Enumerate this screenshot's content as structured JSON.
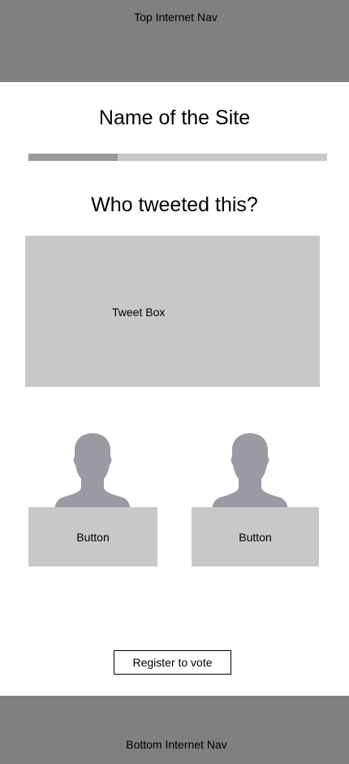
{
  "top_nav": {
    "label": "Top Internet Nav"
  },
  "site": {
    "title": "Name of the Site"
  },
  "progress": {
    "fraction": 0.3
  },
  "question": {
    "text": "Who tweeted this?"
  },
  "tweet_box": {
    "label": "Tweet Box"
  },
  "candidates": [
    {
      "avatar_icon": "person-silhouette-icon",
      "button_label": "Button"
    },
    {
      "avatar_icon": "person-silhouette-icon",
      "button_label": "Button"
    }
  ],
  "register": {
    "label": "Register to vote"
  },
  "bottom_nav": {
    "label": "Bottom Internet Nav"
  },
  "colors": {
    "nav_bg": "#808080",
    "placeholder_gray": "#c8c8c8",
    "avatar_gray": "#9a9aa3",
    "progress_fill": "#999999"
  }
}
